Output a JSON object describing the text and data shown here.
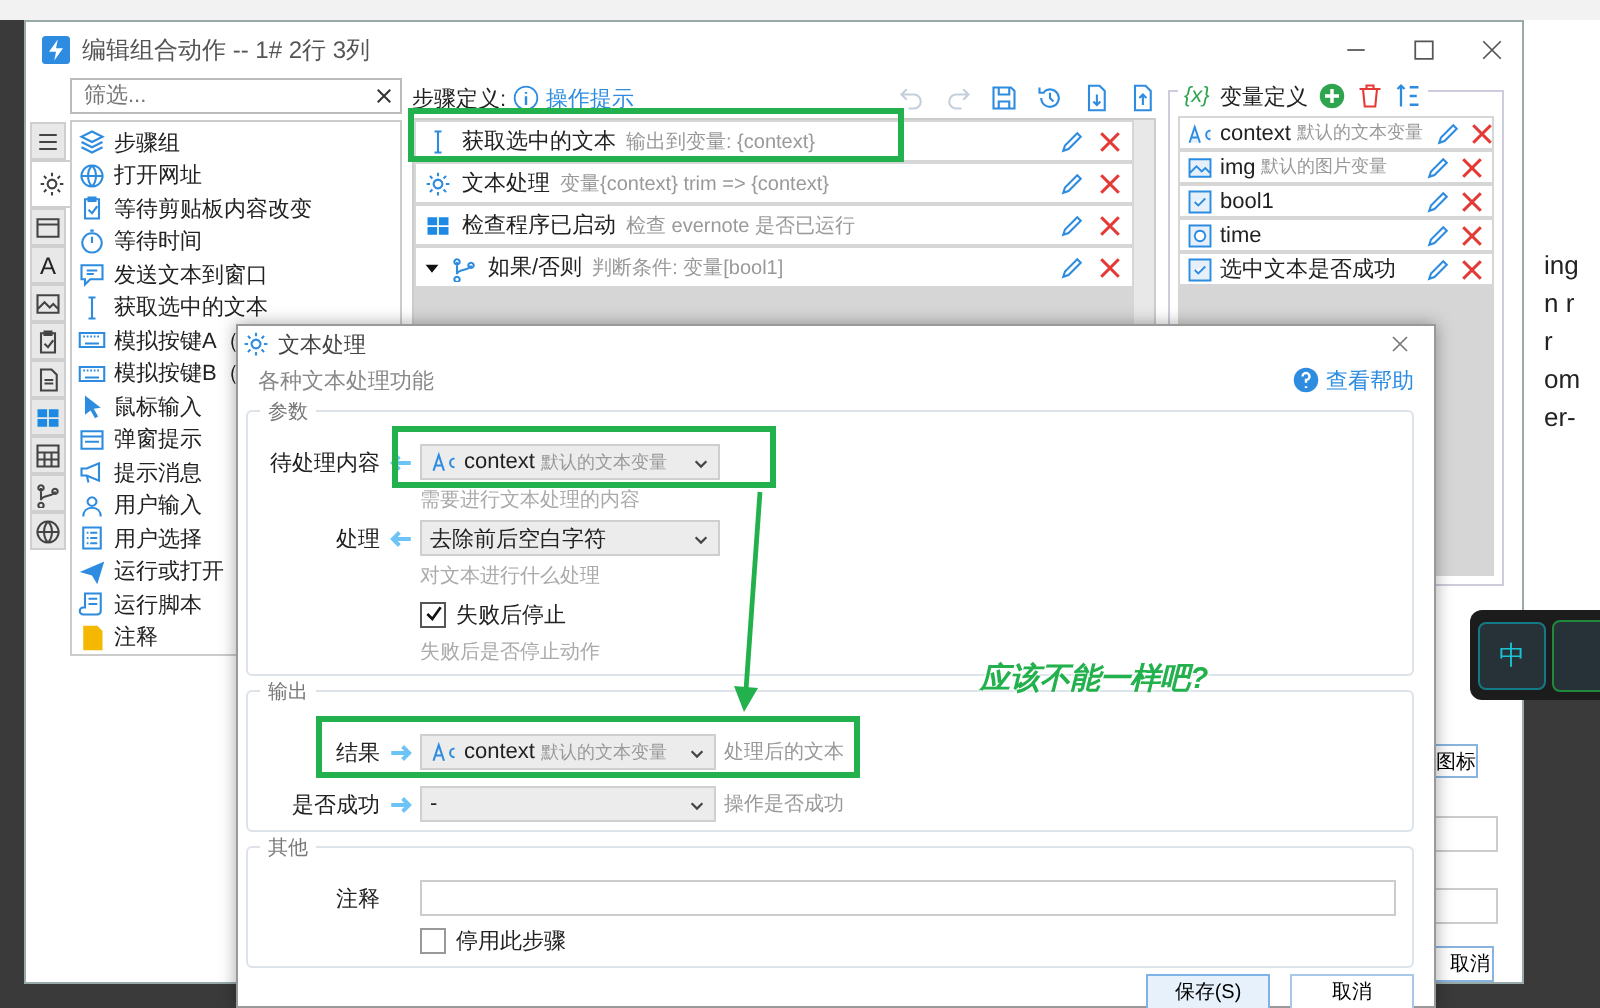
{
  "main_window": {
    "title": "编辑组合动作 -- 1# 2行 3列",
    "filter": {
      "placeholder": "筛选..."
    },
    "side_tabs": [
      {
        "kind": "menu",
        "selected": false
      },
      {
        "kind": "gear",
        "selected": true
      },
      {
        "kind": "window",
        "selected": false
      },
      {
        "kind": "letter",
        "label": "A",
        "selected": false
      },
      {
        "kind": "image",
        "selected": false
      },
      {
        "kind": "clipboard",
        "selected": false
      },
      {
        "kind": "document",
        "selected": false
      },
      {
        "kind": "panes",
        "selected": false
      },
      {
        "kind": "grid",
        "selected": false
      },
      {
        "kind": "branch",
        "selected": false
      },
      {
        "kind": "globe",
        "selected": false
      }
    ],
    "actions": [
      {
        "kind": "layers",
        "label": "步骤组"
      },
      {
        "kind": "globe",
        "label": "打开网址"
      },
      {
        "kind": "clipboard",
        "label": "等待剪贴板内容改变"
      },
      {
        "kind": "clock",
        "label": "等待时间"
      },
      {
        "kind": "chat",
        "label": "发送文本到窗口"
      },
      {
        "kind": "cursor",
        "label": "获取选中的文本"
      },
      {
        "kind": "keyboard",
        "label": "模拟按键A（"
      },
      {
        "kind": "keyboard",
        "label": "模拟按键B（"
      },
      {
        "kind": "pointer",
        "label": "鼠标输入"
      },
      {
        "kind": "popup",
        "label": "弹窗提示"
      },
      {
        "kind": "megaphone",
        "label": "提示消息"
      },
      {
        "kind": "user",
        "label": "用户输入"
      },
      {
        "kind": "list",
        "label": "用户选择"
      },
      {
        "kind": "plane",
        "label": "运行或打开"
      },
      {
        "kind": "script",
        "label": "运行脚本"
      },
      {
        "kind": "note",
        "label": "注释"
      }
    ],
    "steps_label": "步骤定义:",
    "hint_link": "操作提示",
    "toolbar": [
      {
        "kind": "undo",
        "disabled": true
      },
      {
        "kind": "redo",
        "disabled": true
      },
      {
        "kind": "save",
        "disabled": false
      },
      {
        "kind": "history",
        "disabled": false
      },
      {
        "kind": "import",
        "disabled": false
      },
      {
        "kind": "export",
        "disabled": false
      }
    ],
    "steps": [
      {
        "kind": "cursor",
        "title": "获取选中的文本",
        "desc": "输出到变量: {context}"
      },
      {
        "kind": "gear",
        "title": "文本处理",
        "desc": "变量{context} trim => {context}"
      },
      {
        "kind": "panes",
        "title": "检查程序已启动",
        "desc": "检查 evernote 是否已运行"
      },
      {
        "kind": "branch",
        "title": "如果/否则",
        "desc": "判断条件: 变量[bool1]",
        "expanded": true
      }
    ],
    "variables_icon": "{x}",
    "variables_title": "变量定义",
    "variables": [
      {
        "kind": "textvar",
        "name": "context",
        "desc": "默认的文本变量"
      },
      {
        "kind": "imagevar",
        "name": "img",
        "desc": "默认的图片变量"
      },
      {
        "kind": "boolvar",
        "name": "bool1"
      },
      {
        "kind": "timevar",
        "name": "time"
      },
      {
        "kind": "boolvar",
        "name": "选中文本是否成功"
      }
    ],
    "icon_button": "图标",
    "cancel_button": "取消"
  },
  "dialog": {
    "title": "文本处理",
    "subtitle": "各种文本处理功能",
    "help_link": "查看帮助",
    "groups": [
      {
        "title": "参数",
        "rows": [
          {
            "kind": "incombo",
            "label": "待处理内容",
            "variable": true,
            "value": "context",
            "value_desc": "默认的文本变量",
            "hint": "需要进行文本处理的内容"
          },
          {
            "kind": "incombo",
            "label": "处理",
            "variable": false,
            "value": "去除前后空白字符",
            "hint": "对文本进行什么处理"
          },
          {
            "kind": "checkbox",
            "label": "失败后停止",
            "checked": true,
            "hint": "失败后是否停止动作"
          }
        ]
      },
      {
        "title": "输出",
        "rows": [
          {
            "kind": "outcombo",
            "label": "结果",
            "variable": true,
            "value": "context",
            "value_desc": "默认的文本变量",
            "note": "处理后的文本"
          },
          {
            "kind": "outcombo",
            "label": "是否成功",
            "variable": false,
            "value": "-",
            "note": "操作是否成功"
          }
        ]
      },
      {
        "title": "其他",
        "rows": [
          {
            "kind": "input",
            "label": "注释"
          },
          {
            "kind": "checkbox",
            "label": "停用此步骤",
            "checked": false
          }
        ]
      }
    ],
    "buttons": [
      {
        "label": "保存(S)",
        "default": true
      },
      {
        "label": "取消",
        "default": false
      }
    ]
  },
  "annotation": {
    "note": "应该不能一样吧?"
  },
  "ime": {
    "key": "中"
  },
  "page_fragments": [
    "ing",
    "n r",
    "r",
    "om",
    "er-"
  ]
}
